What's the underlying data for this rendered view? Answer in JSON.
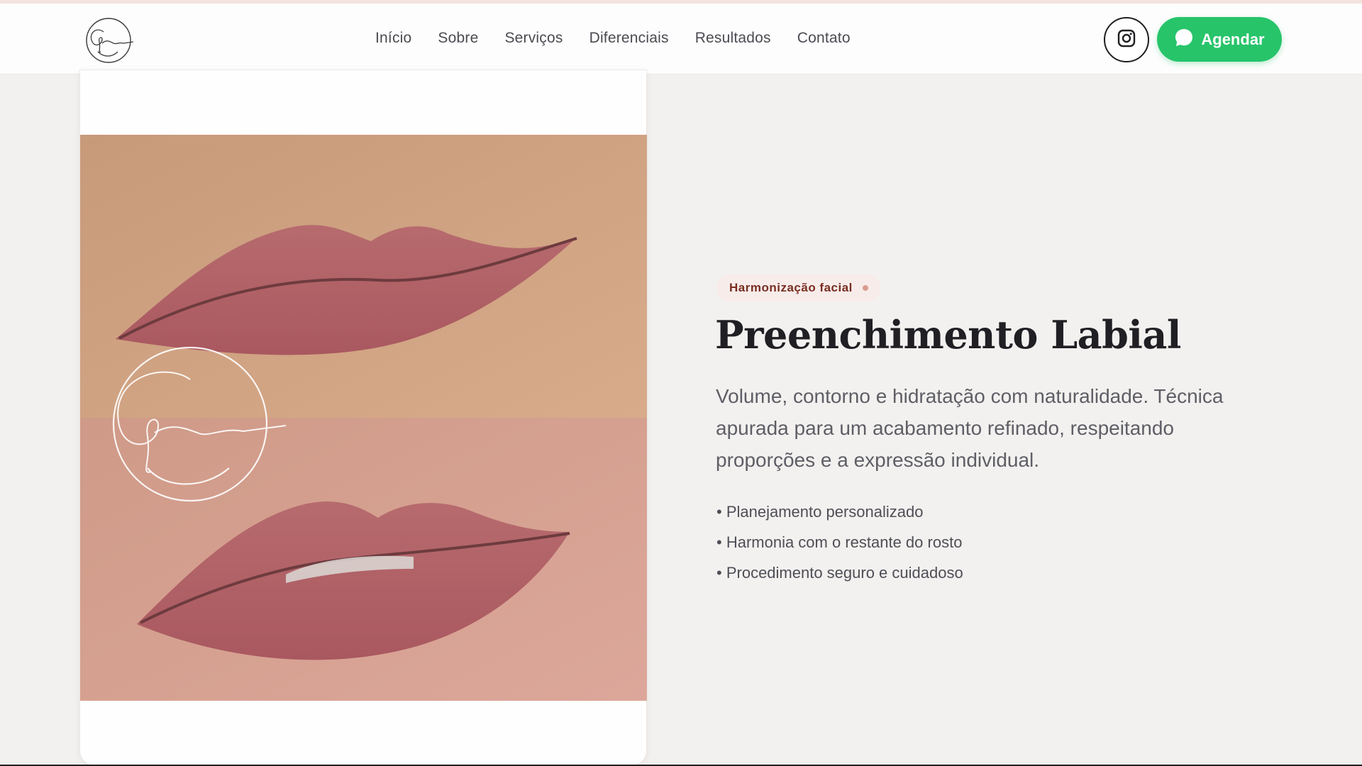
{
  "header": {
    "logo_icon": "monogram-gs-logo-icon",
    "nav": [
      "Início",
      "Sobre",
      "Serviços",
      "Diferenciais",
      "Resultados",
      "Contato"
    ],
    "instagram_icon": "instagram-icon",
    "cta": {
      "icon": "whatsapp-icon",
      "label": "Agendar",
      "color": "#27c46a"
    }
  },
  "card": {
    "image_icon": "before-after-lips-photo"
  },
  "content": {
    "tag": "Harmonização facial",
    "title": "Preenchimento Labial",
    "description": "Volume, contorno e hidratação com naturalidade. Técnica apurada para um acabamento refinado, respeitando proporções e a expressão individual.",
    "bullets": [
      "Planejamento personalizado",
      "Harmonia com o restante do rosto",
      "Procedimento seguro e cuidadoso"
    ]
  }
}
